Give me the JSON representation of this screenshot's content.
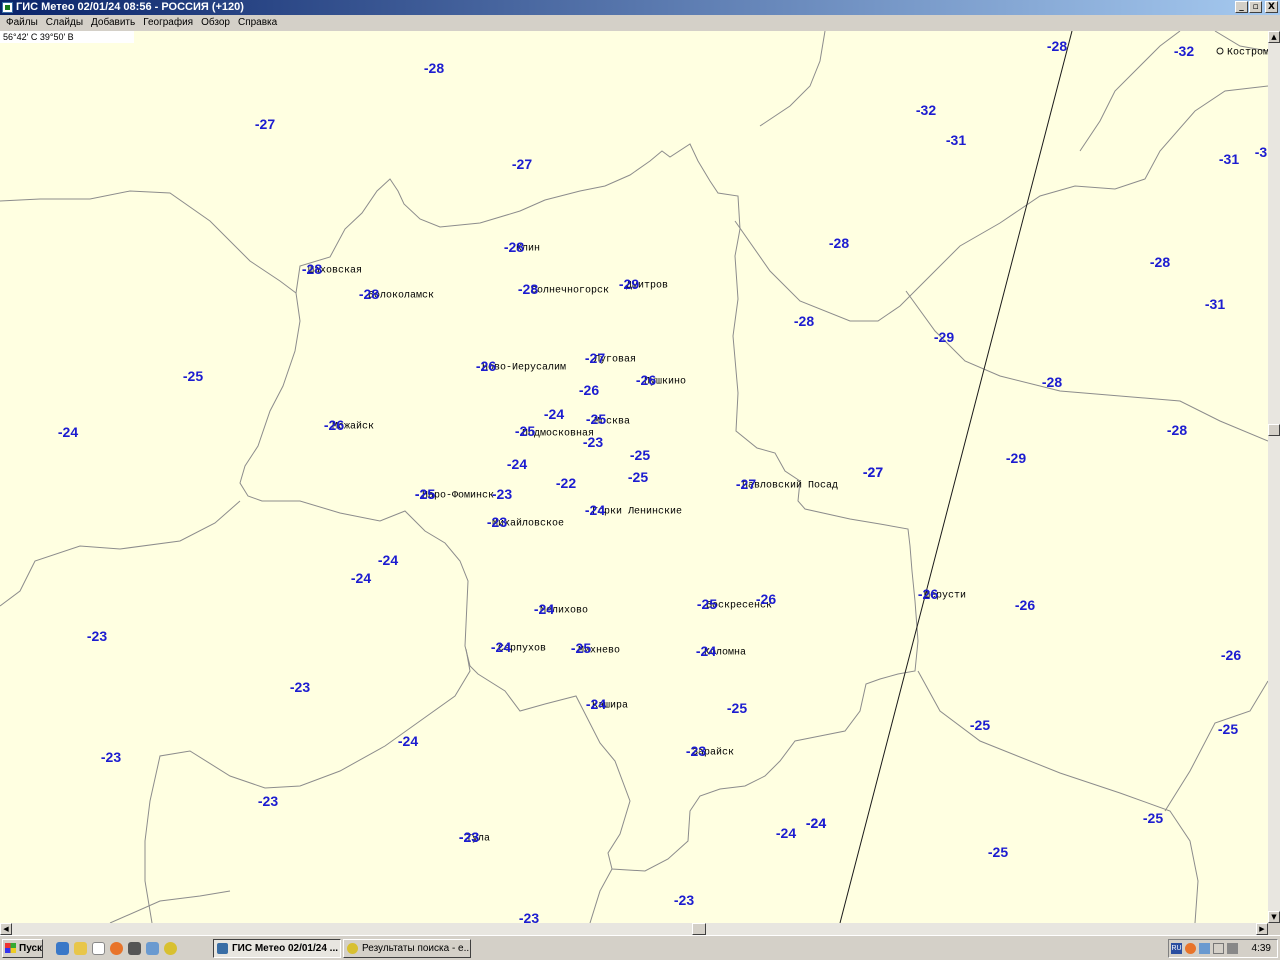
{
  "window": {
    "title": "ГИС Метео 02/01/24 08:56 - РОССИЯ (+120)",
    "buttons": {
      "minimize": "_",
      "maximize": "▫",
      "close": "X"
    }
  },
  "menu": [
    "Файлы",
    "Слайды",
    "Добавить",
    "География",
    "Обзор",
    "Справка"
  ],
  "map": {
    "coords_readout": "56°42' С 39°50' В",
    "cities": [
      {
        "name": "Кострома",
        "marker": true
      },
      {
        "name": "Клин"
      },
      {
        "name": "Шаховская"
      },
      {
        "name": "Волоколамск"
      },
      {
        "name": "Солнечногорск"
      },
      {
        "name": "Дмитров"
      },
      {
        "name": "Луговая"
      },
      {
        "name": "Ново-Иерусалим"
      },
      {
        "name": "Пушкино"
      },
      {
        "name": "Можайск"
      },
      {
        "name": "Москва"
      },
      {
        "name": "Подмосковная"
      },
      {
        "name": "Наро-Фоминск"
      },
      {
        "name": "Горки Ленинские"
      },
      {
        "name": "Павловский Посад"
      },
      {
        "name": "Михайловское"
      },
      {
        "name": "Шерусти"
      },
      {
        "name": "Воскресенск"
      },
      {
        "name": "Мелихово"
      },
      {
        "name": "Серпухов"
      },
      {
        "name": "Михнево"
      },
      {
        "name": "Коломна"
      },
      {
        "name": "Кашира"
      },
      {
        "name": "Зарайск"
      },
      {
        "name": "Тула"
      }
    ],
    "temperatures": [
      "-28",
      "-32",
      "-28",
      "-27",
      "-32",
      "-31",
      "-27",
      "-31",
      "-3",
      "-28",
      "-28",
      "-28",
      "-28",
      "-29",
      "-28",
      "-31",
      "-28",
      "-29",
      "-25",
      "-27",
      "-28",
      "-26",
      "-27",
      "-26",
      "-26",
      "-28",
      "-24",
      "-25",
      "-24",
      "-26",
      "-25",
      "-25",
      "-23",
      "-28",
      "-25",
      "-29",
      "-24",
      "-25",
      "-27",
      "-27",
      "-22",
      "-25",
      "-23",
      "-24",
      "-23",
      "-24",
      "-24",
      "-24",
      "-26",
      "-26",
      "-26",
      "-23",
      "-24",
      "-25",
      "-25",
      "-24",
      "-26",
      "-24",
      "-23",
      "-25",
      "-24",
      "-25",
      "-25",
      "-23",
      "-23",
      "-23",
      "-24",
      "-23",
      "-24",
      "-24",
      "-25",
      "-25",
      "-23",
      "-23",
      "-23"
    ]
  },
  "taskbar": {
    "start_label": "Пуск",
    "tasks": [
      "ГИС Метео 02/01/24 ...",
      "Результаты поиска - е..."
    ],
    "tray_lang": "RU",
    "clock": "4:39"
  }
}
